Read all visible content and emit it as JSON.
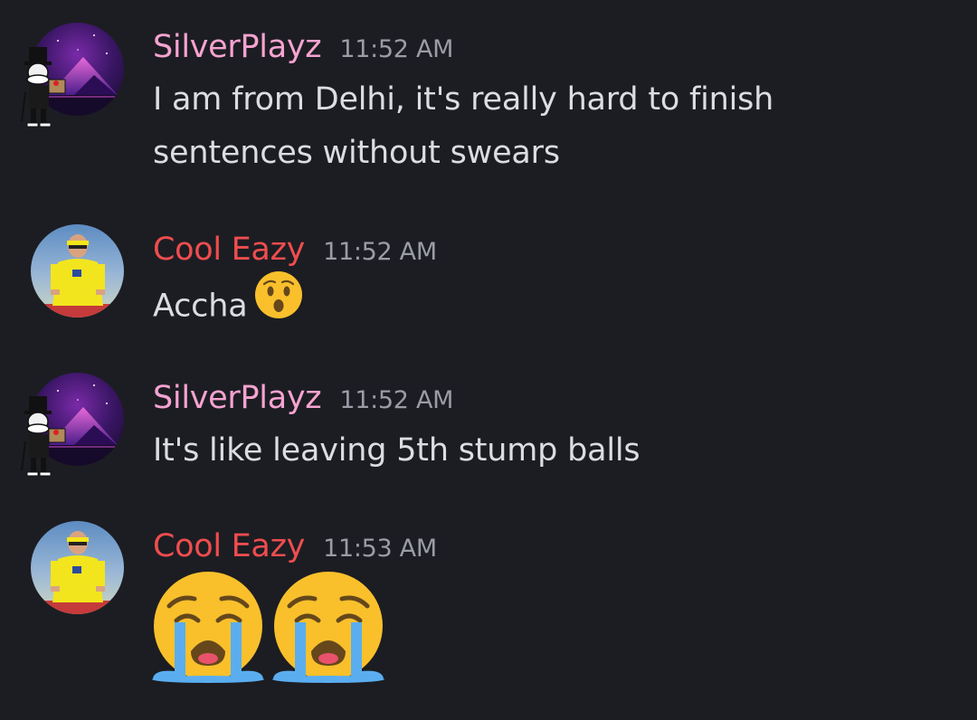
{
  "colors": {
    "background": "#1c1d22",
    "silver_name": "#f5a3d0",
    "cool_name": "#ee4d4f",
    "timestamp": "#9a9ca6",
    "message_text": "#dcdde2"
  },
  "messages": [
    {
      "author": "SilverPlayz",
      "time": "11:52 AM",
      "lines": [
        "I am from Delhi, it's really hard to finish",
        "sentences without swears"
      ],
      "avatar": "purple-mountain-avatar"
    },
    {
      "author": "Cool Eazy",
      "time": "11:52 AM",
      "text": "Accha",
      "emoji": "hushed-face-emoji",
      "avatar": "cricketer-avatar"
    },
    {
      "author": "SilverPlayz",
      "time": "11:52 AM",
      "text": "It's like leaving 5th stump balls",
      "avatar": "purple-mountain-avatar"
    },
    {
      "author": "Cool Eazy",
      "time": "11:53 AM",
      "emoji": [
        "loudly-crying-face-emoji",
        "loudly-crying-face-emoji"
      ],
      "avatar": "cricketer-avatar"
    }
  ]
}
